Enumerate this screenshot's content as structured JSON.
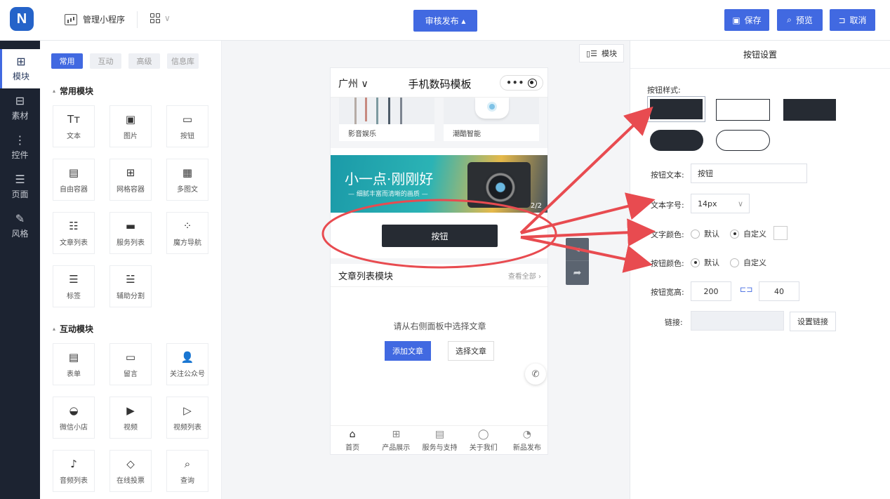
{
  "topbar": {
    "logo": "N",
    "manage_label": "管理小程序",
    "publish_label": "审核发布 ▴",
    "save_label": "保存",
    "preview_label": "预览",
    "cancel_label": "取消",
    "accent": "#4169e1"
  },
  "leftnav": [
    {
      "icon": "plus-square-icon",
      "glyph": "⊞",
      "label": "模块"
    },
    {
      "icon": "material-icon",
      "glyph": "⊟",
      "label": "素材"
    },
    {
      "icon": "control-icon",
      "glyph": "⋮",
      "label": "控件"
    },
    {
      "icon": "page-icon",
      "glyph": "☰",
      "label": "页面"
    },
    {
      "icon": "style-wand-icon",
      "glyph": "✎",
      "label": "风格"
    }
  ],
  "component_tabs": [
    "常用",
    "互动",
    "高级",
    "信息库"
  ],
  "common_section": "常用模块",
  "common_items": [
    {
      "icon": "text-icon",
      "glyph": "Tт",
      "label": "文本"
    },
    {
      "icon": "image-icon",
      "glyph": "▣",
      "label": "图片"
    },
    {
      "icon": "button-icon",
      "glyph": "▭",
      "label": "按钮"
    },
    {
      "icon": "free-container-icon",
      "glyph": "▤",
      "label": "自由容器"
    },
    {
      "icon": "grid-container-icon",
      "glyph": "⊞",
      "label": "网格容器"
    },
    {
      "icon": "multi-image-text-icon",
      "glyph": "▦",
      "label": "多图文"
    },
    {
      "icon": "article-list-icon",
      "glyph": "☷",
      "label": "文章列表"
    },
    {
      "icon": "service-list-icon",
      "glyph": "▬",
      "label": "服务列表"
    },
    {
      "icon": "magic-nav-icon",
      "glyph": "⁘",
      "label": "魔方导航"
    },
    {
      "icon": "tag-icon",
      "glyph": "☰",
      "label": "标签"
    },
    {
      "icon": "divider-icon",
      "glyph": "☱",
      "label": "辅助分割"
    }
  ],
  "interactive_section": "互动模块",
  "interactive_items": [
    {
      "icon": "form-icon",
      "glyph": "▤",
      "label": "表单"
    },
    {
      "icon": "message-icon",
      "glyph": "▭",
      "label": "留言"
    },
    {
      "icon": "follow-account-icon",
      "glyph": "👤",
      "label": "关注公众号"
    },
    {
      "icon": "wechat-shop-icon",
      "glyph": "◒",
      "label": "微信小店"
    },
    {
      "icon": "video-icon",
      "glyph": "▶",
      "label": "视频"
    },
    {
      "icon": "video-list-icon",
      "glyph": "▷",
      "label": "视频列表"
    },
    {
      "icon": "audio-list-icon",
      "glyph": "♪",
      "label": "音频列表"
    },
    {
      "icon": "online-vote-icon",
      "glyph": "◇",
      "label": "在线投票"
    },
    {
      "icon": "query-icon",
      "glyph": "⌕",
      "label": "查询"
    }
  ],
  "canvas": {
    "module_toggle": "模块",
    "phone": {
      "city": "广州 ∨",
      "title": "手机数码模板",
      "cards": [
        "影音娱乐",
        "潮酷智能"
      ],
      "banner_title": "小一点·刚刚好",
      "banner_sub": "— 细腻丰富而清晰的画质 —",
      "banner_page": "2/2",
      "button_label": "按钮",
      "article_title": "文章列表模块",
      "article_more": "查看全部",
      "article_empty": "请从右侧面板中选择文章",
      "add_article": "添加文章",
      "select_article": "选择文章",
      "tabbar": [
        {
          "icon": "home-icon",
          "glyph": "⌂",
          "label": "首页"
        },
        {
          "icon": "product-icon",
          "glyph": "⊞",
          "label": "产品展示"
        },
        {
          "icon": "service-icon",
          "glyph": "▤",
          "label": "服务与支持"
        },
        {
          "icon": "about-icon",
          "glyph": "◯",
          "label": "关于我们"
        },
        {
          "icon": "news-icon",
          "glyph": "◔",
          "label": "新品发布"
        }
      ]
    }
  },
  "settings": {
    "title": "按钮设置",
    "style_label": "按钮样式:",
    "text_label": "按钮文本:",
    "text_value": "按钮",
    "size_label": "文本字号:",
    "size_value": "14px",
    "text_color_label": "文字颜色:",
    "text_color_opts": [
      "默认",
      "自定义"
    ],
    "btn_color_label": "按钮颜色:",
    "btn_color_opts": [
      "默认",
      "自定义"
    ],
    "wh_label": "按钮宽高:",
    "width": "200",
    "height": "40",
    "link_label": "链接:",
    "link_btn": "设置链接"
  }
}
